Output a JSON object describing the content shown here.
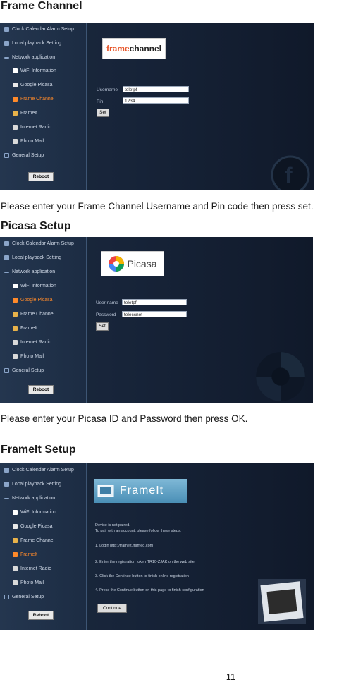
{
  "sections": {
    "frame_channel": {
      "heading": "Frame Channel",
      "caption": "Please enter your Frame Channel Username and Pin code then press set.",
      "logo": {
        "part1": "frame",
        "part2": "channel"
      },
      "username_label": "Username",
      "username_value": "teletpf",
      "pin_label": "Pin",
      "pin_value": "1234",
      "button": "Set"
    },
    "picasa": {
      "heading": "Picasa Setup",
      "caption": "Please enter your Picasa ID and Password then press OK.",
      "logo": "Picasa",
      "username_label": "User name",
      "username_value": "teletpf",
      "password_label": "Password",
      "password_value": "teleccnet",
      "button": "Set"
    },
    "frameit": {
      "heading": "FrameIt Setup",
      "logo": "FrameIt",
      "intro1": "Device is not paired.",
      "intro2": "To pair with an account, please follow these steps:",
      "steps": [
        "1. Login http://frameit.framed.com",
        "2. Enter the registration token TR10-ZJAK on the web site",
        "3. Click the Continue button to finish online registration",
        "4. Press the Continue button on this page to finish configuration"
      ],
      "button": "Continue"
    }
  },
  "menu": {
    "items": [
      "Clock Calendar Alarm Setup",
      "Local playback Setting",
      "Network application",
      "WiFi Information",
      "Google Picasa",
      "Frame Channel",
      "FrameIt",
      "Internet Radio",
      "Photo Mail",
      "General Setup"
    ],
    "reboot": "Reboot"
  },
  "page_number": "11",
  "colors": {
    "accent": "#ff8a2a",
    "panel_bg": "#1b2a3e",
    "sidebar_bg": "#24364f"
  }
}
